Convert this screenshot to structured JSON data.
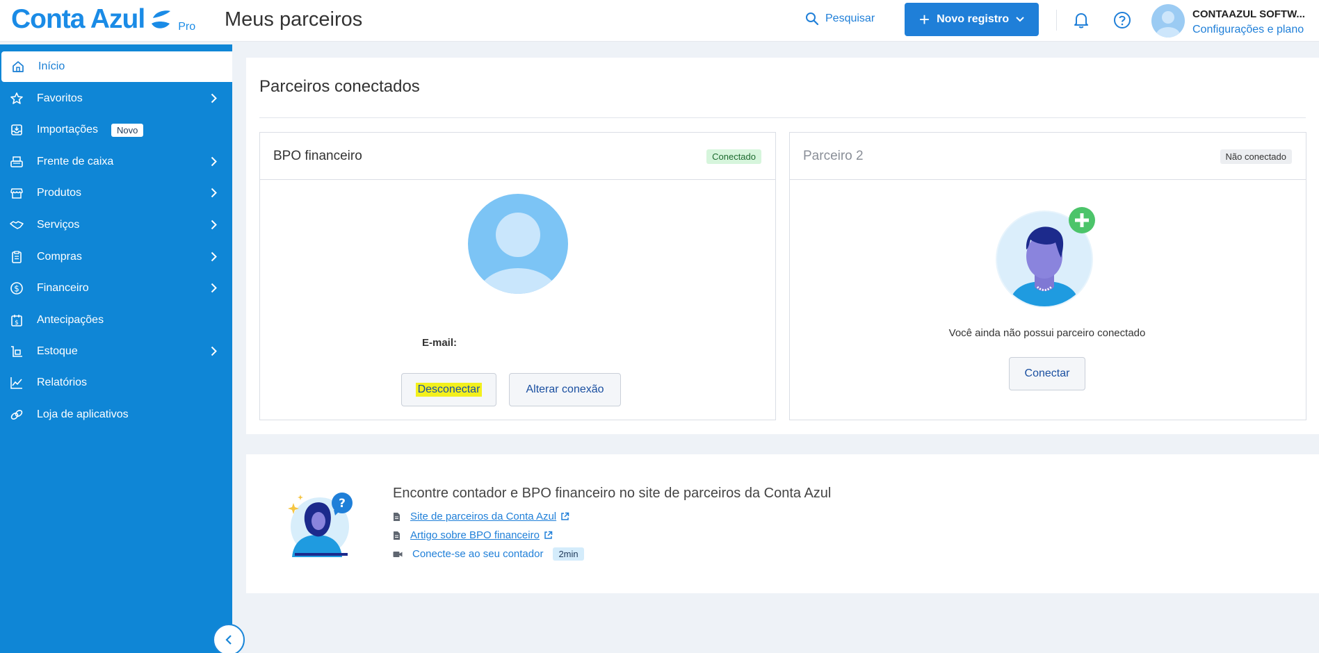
{
  "header": {
    "logo_text": "Conta Azul",
    "logo_plan": "Pro",
    "page_title": "Meus parceiros",
    "search_label": "Pesquisar",
    "new_record_label": "Novo registro",
    "company_name": "CONTAAZUL SOFTW...",
    "settings_link": "Configurações e plano"
  },
  "sidebar": {
    "items": [
      {
        "label": "Início",
        "icon": "home-icon",
        "active": true
      },
      {
        "label": "Favoritos",
        "icon": "star-icon"
      },
      {
        "label": "Importações",
        "icon": "import-icon",
        "badge": "Novo"
      },
      {
        "label": "Frente de caixa",
        "icon": "cash-register-icon"
      },
      {
        "label": "Produtos",
        "icon": "store-icon"
      },
      {
        "label": "Serviços",
        "icon": "handshake-icon"
      },
      {
        "label": "Compras",
        "icon": "clipboard-icon"
      },
      {
        "label": "Financeiro",
        "icon": "dollar-icon"
      },
      {
        "label": "Antecipações",
        "icon": "calendar-dollar-icon"
      },
      {
        "label": "Estoque",
        "icon": "stock-icon"
      },
      {
        "label": "Relatórios",
        "icon": "chart-icon"
      },
      {
        "label": "Loja de aplicativos",
        "icon": "link-icon"
      }
    ]
  },
  "main": {
    "section_title": "Parceiros conectados",
    "cards": [
      {
        "title": "BPO financeiro",
        "status": "Conectado",
        "email_label": "E-mail:",
        "buttons": [
          "Desconectar",
          "Alterar conexão"
        ]
      },
      {
        "title": "Parceiro 2",
        "status": "Não conectado",
        "empty_text": "Você ainda não possui parceiro conectado",
        "button": "Conectar"
      }
    ],
    "resources": {
      "title": "Encontre contador e BPO financeiro no site de parceiros da Conta Azul",
      "links": [
        {
          "label": "Site de parceiros da Conta Azul",
          "icon": "document-icon"
        },
        {
          "label": "Artigo sobre BPO financeiro",
          "icon": "document-icon"
        },
        {
          "label": "Conecte-se ao seu contador",
          "icon": "video-icon",
          "badge": "2min"
        }
      ]
    }
  },
  "colors": {
    "brand": "#1a8be6",
    "sidebar": "#0f86d6",
    "primary_button": "#1f7fd8",
    "connected": "#d6f5dc",
    "highlight": "#f3f01d"
  }
}
